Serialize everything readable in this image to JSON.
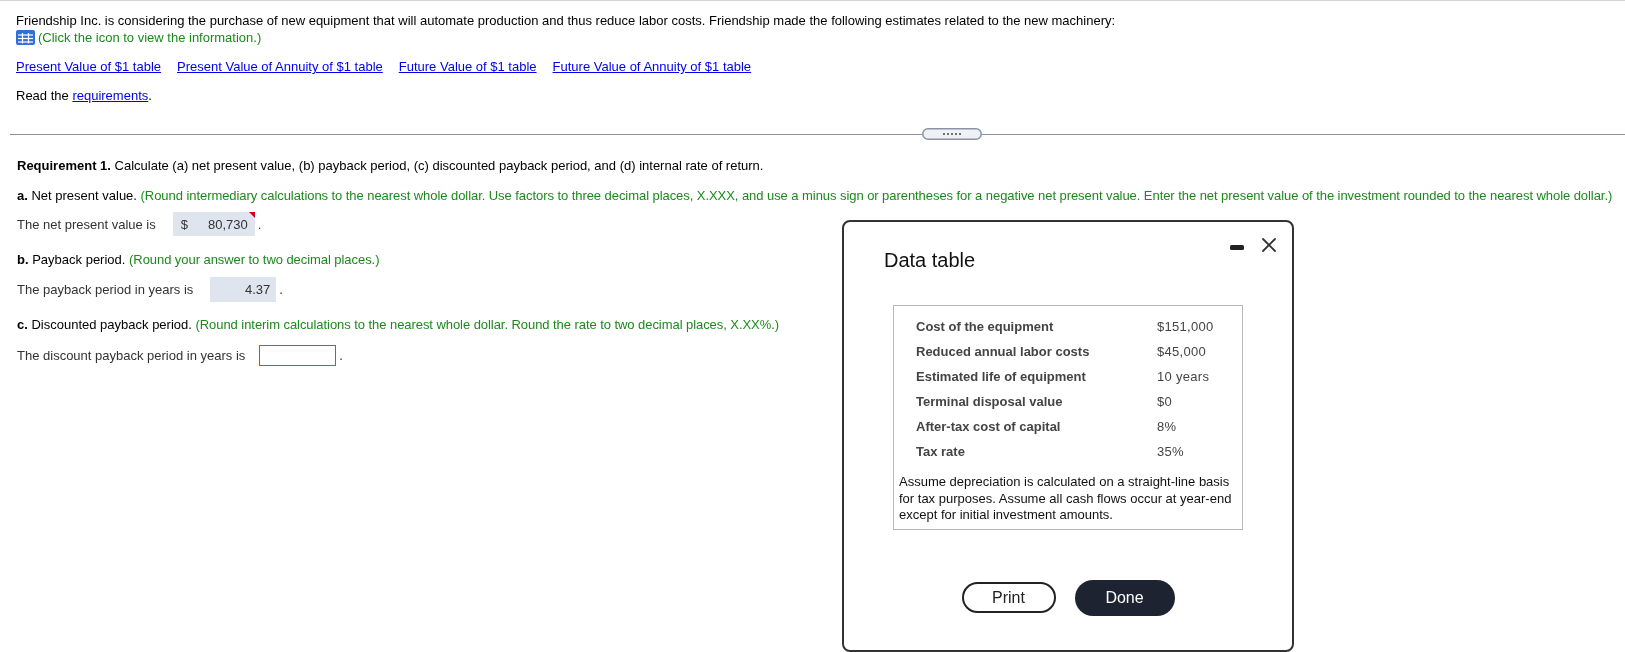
{
  "intro": {
    "text": "Friendship Inc. is considering the purchase of new equipment that will automate production and thus reduce labor costs. Friendship made the following estimates related to the new machinery:",
    "info_hint": "(Click the icon to view the information.)"
  },
  "table_links": [
    "Present Value of $1 table",
    "Present Value of Annuity of $1 table",
    "Future Value of $1 table",
    "Future Value of Annuity of $1 table"
  ],
  "read_requirements": {
    "before": "Read the",
    "link": "requirements",
    "after": "."
  },
  "requirement": "**Requirement 1.** Calculate (a) net present value, (b) payback period, (c) discounted payback period, and (d) internal rate of return.",
  "parts": [
    {
      "heading": "**a.** Net present value.",
      "instruction": "(Round intermediary calculations to the nearest whole dollar. Use factors to three decimal places, X.XXX, and use a minus sign or parentheses for a negative net present value. Enter the net present value of the investment rounded to the nearest whole dollar.)",
      "prompt": "The net present value is",
      "answer": {
        "prefix": "$",
        "value": "80,730",
        "answered": true,
        "flagged": true
      },
      "end": "."
    },
    {
      "heading": "**b.** Payback period.",
      "instruction": "(Round your answer to two decimal places.)",
      "prompt": "The payback period in years is",
      "answer": {
        "value": "4.37",
        "answered": true,
        "flagged": false
      },
      "end": "."
    },
    {
      "heading": "**c.** Discounted payback period.",
      "instruction": "(Round interim calculations to the nearest whole dollar. Round the rate to two decimal places, X.XX%.)",
      "prompt": "The discount payback period in years is",
      "answer": {
        "answered": false,
        "flagged": false
      },
      "end": "."
    }
  ],
  "dialog": {
    "title": "Data table",
    "rows": [
      {
        "label": "Cost of the equipment",
        "value": "$151,000"
      },
      {
        "label": "Reduced annual labor costs",
        "value": "$45,000"
      },
      {
        "label": "Estimated life of equipment",
        "value": "10 years"
      },
      {
        "label": "Terminal disposal value",
        "value": "$0"
      },
      {
        "label": "After-tax cost of capital",
        "value": "8%"
      },
      {
        "label": "Tax rate",
        "value": "35%"
      }
    ],
    "note": "Assume depreciation is calculated on a straight-line basis for tax purposes. Assume all cash flows occur at year-end except for initial investment amounts.",
    "buttons": [
      {
        "label": "Print",
        "kind": "outline"
      },
      {
        "label": "Done",
        "kind": "filled"
      }
    ]
  }
}
